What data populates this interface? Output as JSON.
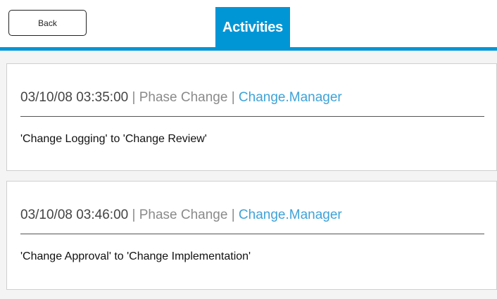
{
  "header": {
    "back_label": "Back",
    "active_tab_label": "Activities"
  },
  "activities": [
    {
      "timestamp": "03/10/08 03:35:00",
      "separator_1": " | ",
      "type": "Phase Change",
      "separator_2": " | ",
      "user": "Change.Manager",
      "description": "'Change Logging' to 'Change Review'"
    },
    {
      "timestamp": "03/10/08 03:46:00",
      "separator_1": " | ",
      "type": "Phase Change",
      "separator_2": " | ",
      "user": "Change.Manager",
      "description": "'Change Approval' to 'Change Implementation'"
    }
  ],
  "colors": {
    "accent": "#0096d6",
    "link": "#3ea2d8",
    "muted": "#8a8a8a"
  }
}
